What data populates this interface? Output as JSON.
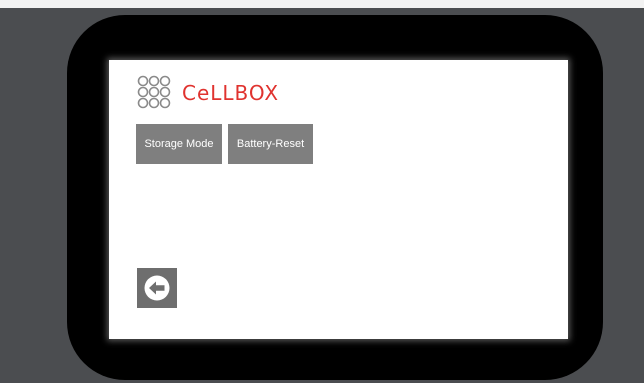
{
  "logo": {
    "text": "CeLLBOX",
    "color": "#e0332f",
    "mark_icon": "circle-grid-icon"
  },
  "buttons": {
    "storage_mode": "Storage Mode",
    "battery_reset": "Battery-Reset"
  },
  "back_icon": "arrow-left-circle-icon",
  "colors": {
    "button_bg": "#7f7f7f",
    "back_button_bg": "#6e6e6e",
    "bezel": "#000000",
    "background": "#4b4d50",
    "screen": "#ffffff"
  }
}
